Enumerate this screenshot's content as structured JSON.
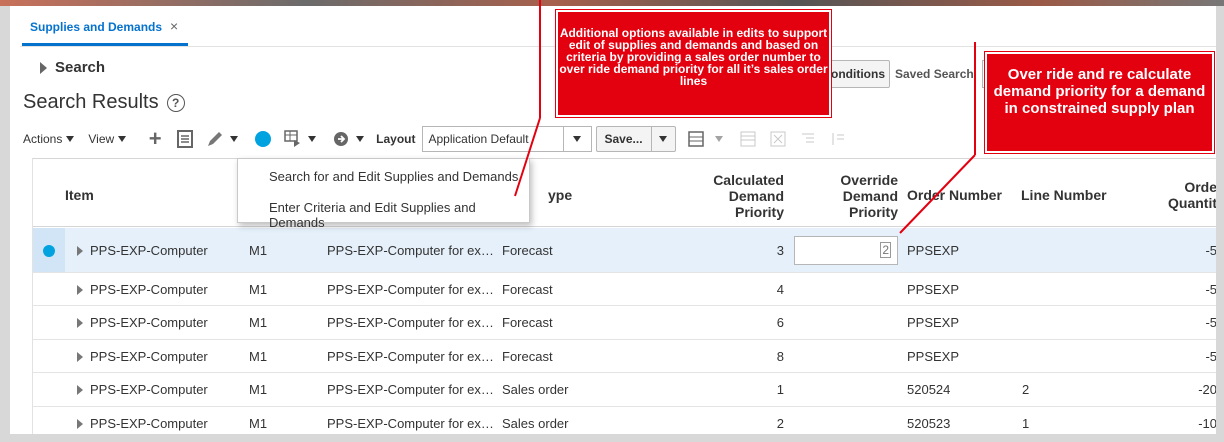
{
  "tab": {
    "label": "Supplies and Demands",
    "close": "×"
  },
  "search": {
    "label": "Search"
  },
  "results": {
    "title": "Search Results",
    "help": "?"
  },
  "header_right": {
    "conditions_label": "onditions",
    "saved_search_label": "Saved Search"
  },
  "toolbar": {
    "actions_label": "Actions",
    "view_label": "View",
    "layout_label": "Layout",
    "layout_value": "Application Default",
    "save_label": "Save...",
    "icons": [
      "plus-icon",
      "list-icon",
      "edit-icon",
      "blue-dot-icon",
      "freeze-icon",
      "arrow-circle-icon",
      "columns-icon",
      "detach-icon",
      "wrap-icon",
      "sort-icon"
    ]
  },
  "edit_menu": {
    "items": [
      "Search for and Edit Supplies and Demands",
      "Enter Criteria and Edit Supplies and Demands"
    ]
  },
  "columns": {
    "item": "Item",
    "type": "ype",
    "calc_priority": [
      "Calculated",
      "Demand",
      "Priority"
    ],
    "override_priority": [
      "Override",
      "Demand",
      "Priority"
    ],
    "order_number": "Order Number",
    "line_number": "Line Number",
    "order_qty": [
      "Orde",
      "Quantit"
    ]
  },
  "rows": [
    {
      "item": "PPS-EXP-Computer",
      "org": "M1",
      "desc": "PPS-EXP-Computer for ex…",
      "type": "Forecast",
      "calc": "3",
      "override": "2",
      "order": "PPSEXP",
      "line": "",
      "qty": "-5"
    },
    {
      "item": "PPS-EXP-Computer",
      "org": "M1",
      "desc": "PPS-EXP-Computer for ex…",
      "type": "Forecast",
      "calc": "4",
      "override": "",
      "order": "PPSEXP",
      "line": "",
      "qty": "-5"
    },
    {
      "item": "PPS-EXP-Computer",
      "org": "M1",
      "desc": "PPS-EXP-Computer for ex…",
      "type": "Forecast",
      "calc": "6",
      "override": "",
      "order": "PPSEXP",
      "line": "",
      "qty": "-5"
    },
    {
      "item": "PPS-EXP-Computer",
      "org": "M1",
      "desc": "PPS-EXP-Computer for ex…",
      "type": "Forecast",
      "calc": "8",
      "override": "",
      "order": "PPSEXP",
      "line": "",
      "qty": "-5"
    },
    {
      "item": "PPS-EXP-Computer",
      "org": "M1",
      "desc": "PPS-EXP-Computer for ex…",
      "type": "Sales order",
      "calc": "1",
      "override": "",
      "order": "520524",
      "line": "2",
      "qty": "-20"
    },
    {
      "item": "PPS-EXP-Computer",
      "org": "M1",
      "desc": "PPS-EXP-Computer for ex…",
      "type": "Sales order",
      "calc": "2",
      "override": "",
      "order": "520523",
      "line": "1",
      "qty": "-10"
    }
  ],
  "callouts": {
    "left": "Additional options available in edits to support edit of supplies and demands and based on criteria by providing a sales order number to over ride demand priority for all it’s sales order lines",
    "right": "Over ride and re calculate demand priority for a demand in constrained supply plan"
  },
  "colors": {
    "accent": "#0572ce",
    "selection": "#00a3e0",
    "callout": "#e3000f"
  }
}
